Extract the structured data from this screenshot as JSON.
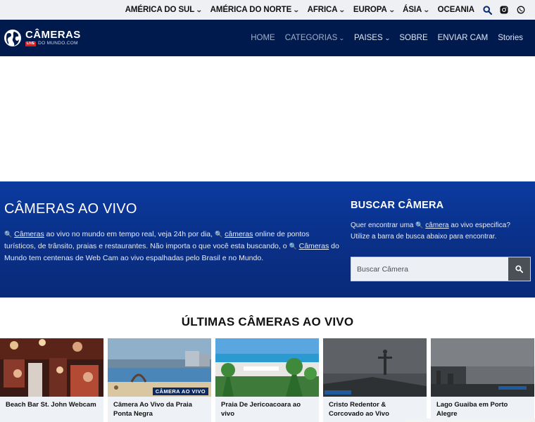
{
  "topbar": {
    "regions": [
      {
        "label": "AMÉRICA DO SUL",
        "dropdown": true
      },
      {
        "label": "AMÉRICA DO NORTE",
        "dropdown": true
      },
      {
        "label": "AFRICA",
        "dropdown": true
      },
      {
        "label": "EUROPA",
        "dropdown": true
      },
      {
        "label": "ÁSIA",
        "dropdown": true
      },
      {
        "label": "OCEANIA",
        "dropdown": false
      }
    ],
    "icons": [
      "search-icon",
      "instagram-icon",
      "whatsapp-icon"
    ]
  },
  "header": {
    "logo_title": "CÂMERAS",
    "logo_live": "LIVE",
    "logo_domain": "DO MUNDO.COM",
    "nav": [
      {
        "label": "HOME",
        "dropdown": false
      },
      {
        "label": "CATEGORIAS",
        "dropdown": true
      },
      {
        "label": "PAISES",
        "dropdown": true
      },
      {
        "label": "SOBRE",
        "dropdown": false
      },
      {
        "label": "ENVIAR CAM",
        "dropdown": false
      },
      {
        "label": "Stories",
        "dropdown": false
      }
    ]
  },
  "hero": {
    "title": "CÂMERAS AO VIVO",
    "p1_link1": "Câmeras",
    "p1_text1": " ao vivo no mundo em tempo real, veja 24h por dia, ",
    "p1_link2": "câmeras",
    "p1_text2": " online de pontos turísticos, de trânsito, praias e restaurantes. Não importa o que você esta buscando, o ",
    "p1_link3": "Câmeras",
    "p1_text3": " do Mundo tem centenas de Web Cam ao vivo espalhadas pelo Brasil e no Mundo."
  },
  "search": {
    "title": "BUSCAR CÂMERA",
    "desc_text1": "Quer encontrar uma ",
    "desc_link": "câmera",
    "desc_text2": " ao vivo especifica? Utilize a barra de busca abaixo para encontrar.",
    "placeholder": "Buscar Câmera"
  },
  "latest": {
    "title": "ÚLTIMAS CÂMERAS AO VIVO",
    "cards": [
      {
        "label": "Beach Bar St. John Webcam",
        "tag": ""
      },
      {
        "label": "Câmera Ao Vivo da Praia Ponta Negra",
        "tag": "CÂMERA AO VIVO"
      },
      {
        "label": "Praia De Jericoacoara ao vivo",
        "tag": ""
      },
      {
        "label": "Cristo Redentor & Corcovado ao Vivo",
        "tag": ""
      },
      {
        "label": "Lago Guaiba em Porto Alegre",
        "tag": ""
      }
    ]
  },
  "colors": {
    "header_bg": "#001a4d",
    "hero_bg": "#0b3aa0",
    "topbar_bg": "#eef0f4",
    "card_label_bg": "#eef1f6"
  }
}
